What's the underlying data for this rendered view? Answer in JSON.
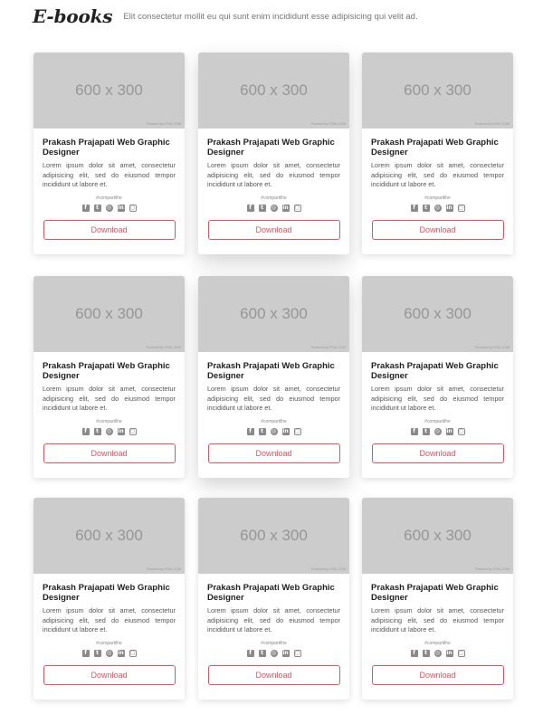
{
  "header": {
    "brand": "E-books",
    "tagline": "Elit consectetur mollit eu qui sunt enim incididunt esse adipisicing qui velit ad."
  },
  "cards": [
    {
      "thumb": "600 x 300",
      "credit": "Powered by HTML.COM",
      "title": "Prakash Prajapati Web Graphic Designer",
      "desc": "Lorem ipsum dolor sit amet, consectetur adipisicing elit, sed do eiusmod tempor incididunt ut labore et.",
      "hashtag": "#compartilhe",
      "button": "Download"
    },
    {
      "thumb": "600 x 300",
      "credit": "Powered by HTML.COM",
      "title": "Prakash Prajapati Web Graphic Designer",
      "desc": "Lorem ipsum dolor sit amet, consectetur adipisicing elit, sed do eiusmod tempor incididunt ut labore et.",
      "hashtag": "#compartilhe",
      "button": "Download"
    },
    {
      "thumb": "600 x 300",
      "credit": "Powered by HTML.COM",
      "title": "Prakash Prajapati Web Graphic Designer",
      "desc": "Lorem ipsum dolor sit amet, consectetur adipisicing elit, sed do eiusmod tempor incididunt ut labore et.",
      "hashtag": "#compartilhe",
      "button": "Download"
    },
    {
      "thumb": "600 x 300",
      "credit": "Powered by HTML.COM",
      "title": "Prakash Prajapati Web Graphic Designer",
      "desc": "Lorem ipsum dolor sit amet, consectetur adipisicing elit, sed do eiusmod tempor incididunt ut labore et.",
      "hashtag": "#compartilhe",
      "button": "Download"
    },
    {
      "thumb": "600 x 300",
      "credit": "Powered by HTML.COM",
      "title": "Prakash Prajapati Web Graphic Designer",
      "desc": "Lorem ipsum dolor sit amet, consectetur adipisicing elit, sed do eiusmod tempor incididunt ut labore et.",
      "hashtag": "#compartilhe",
      "button": "Download"
    },
    {
      "thumb": "600 x 300",
      "credit": "Powered by HTML.COM",
      "title": "Prakash Prajapati Web Graphic Designer",
      "desc": "Lorem ipsum dolor sit amet, consectetur adipisicing elit, sed do eiusmod tempor incididunt ut labore et.",
      "hashtag": "#compartilhe",
      "button": "Download"
    },
    {
      "thumb": "600 x 300",
      "credit": "Powered by HTML.COM",
      "title": "Prakash Prajapati Web Graphic Designer",
      "desc": "Lorem ipsum dolor sit amet, consectetur adipisicing elit, sed do eiusmod tempor incididunt ut labore et.",
      "hashtag": "#compartilhe",
      "button": "Download"
    },
    {
      "thumb": "600 x 300",
      "credit": "Powered by HTML.COM",
      "title": "Prakash Prajapati Web Graphic Designer",
      "desc": "Lorem ipsum dolor sit amet, consectetur adipisicing elit, sed do eiusmod tempor incididunt ut labore et.",
      "hashtag": "#compartilhe",
      "button": "Download"
    },
    {
      "thumb": "600 x 300",
      "credit": "Powered by HTML.COM",
      "title": "Prakash Prajapati Web Graphic Designer",
      "desc": "Lorem ipsum dolor sit amet, consectetur adipisicing elit, sed do eiusmod tempor incididunt ut labore et.",
      "hashtag": "#compartilhe",
      "button": "Download"
    }
  ],
  "social_icons": [
    {
      "name": "facebook-icon",
      "glyph": "f",
      "style": "square"
    },
    {
      "name": "twitter-icon",
      "glyph": "t",
      "style": "square"
    },
    {
      "name": "dribbble-icon",
      "glyph": "◎",
      "style": "round"
    },
    {
      "name": "linkedin-icon",
      "glyph": "in",
      "style": "square"
    },
    {
      "name": "instagram-icon",
      "glyph": "◻",
      "style": "outline"
    }
  ],
  "colors": {
    "accent": "#e05260",
    "thumb_bg": "#cccccc",
    "icon": "#8a8a8a"
  }
}
